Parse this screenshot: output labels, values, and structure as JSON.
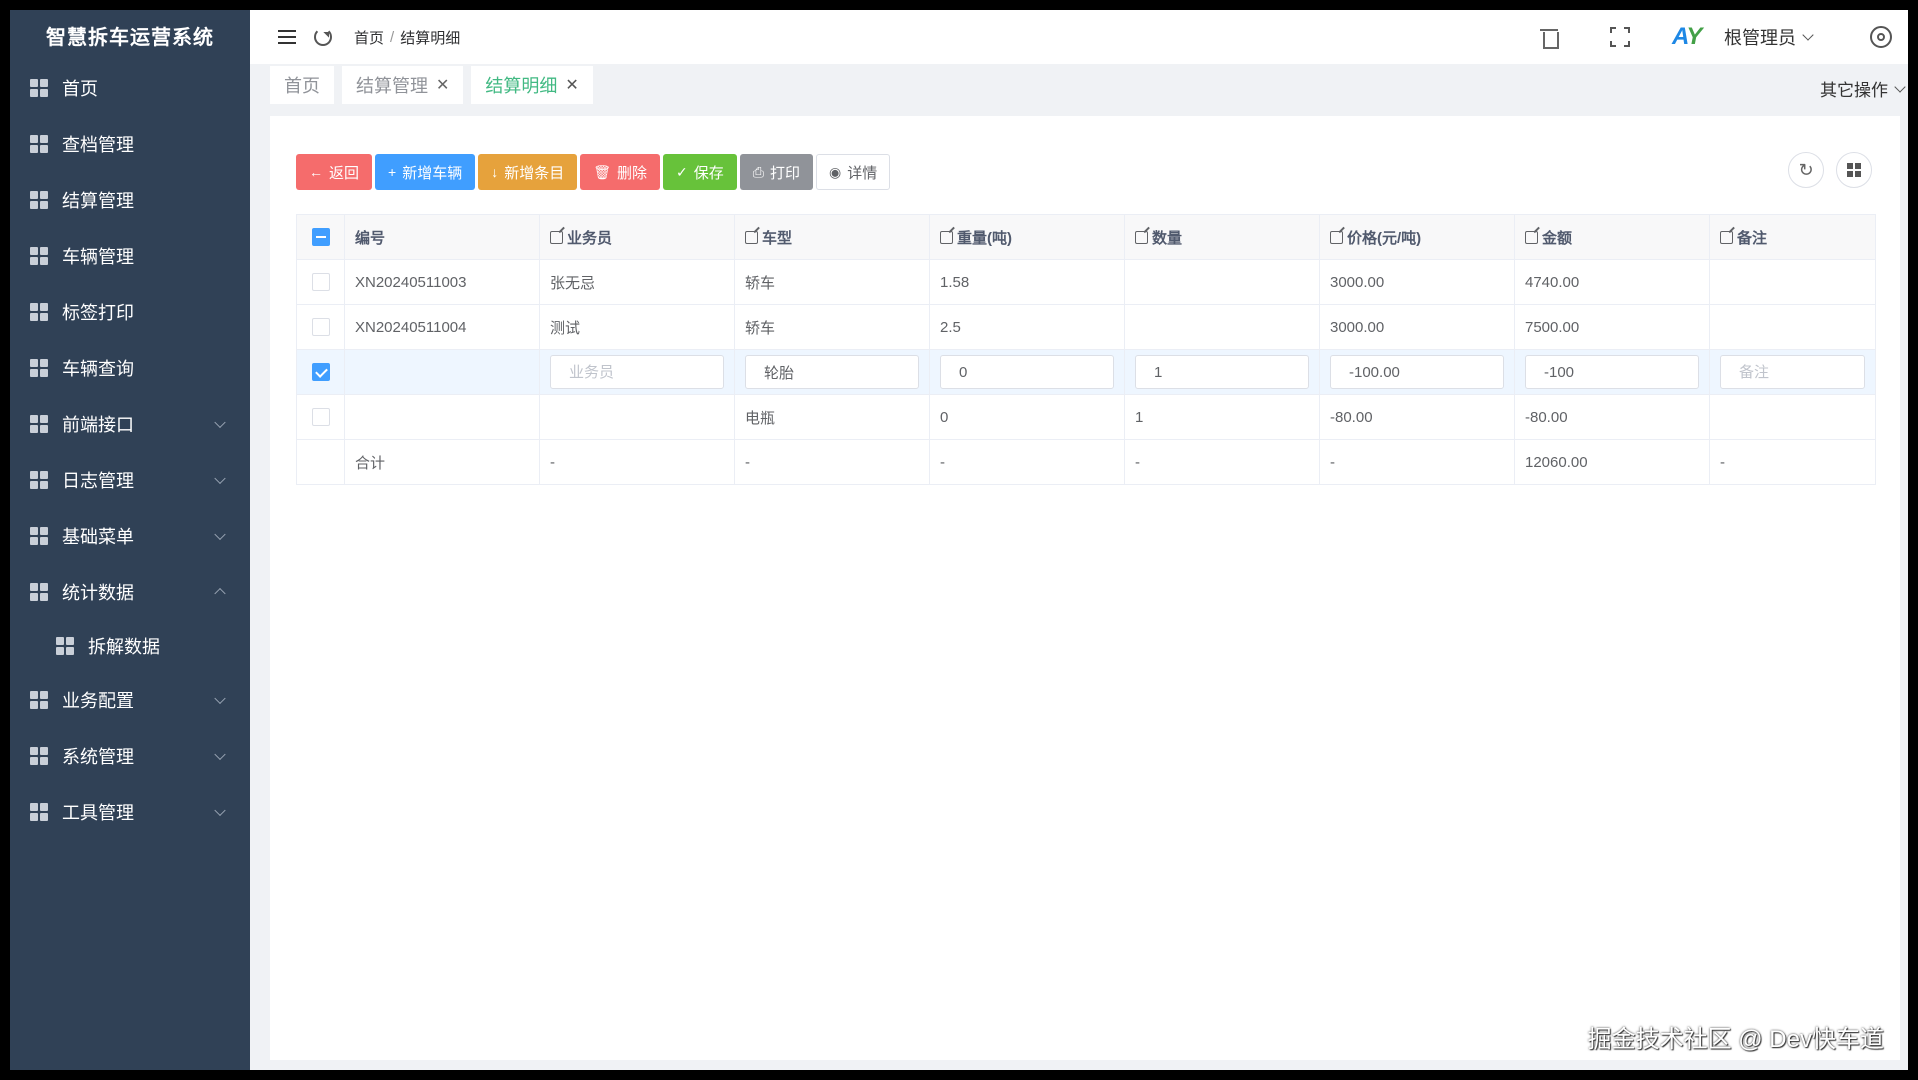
{
  "app_title": "智慧拆车运营系统",
  "sidebar": {
    "items": [
      {
        "label": "首页",
        "has_chevron": false
      },
      {
        "label": "查档管理",
        "has_chevron": false
      },
      {
        "label": "结算管理",
        "has_chevron": false
      },
      {
        "label": "车辆管理",
        "has_chevron": false
      },
      {
        "label": "标签打印",
        "has_chevron": false
      },
      {
        "label": "车辆查询",
        "has_chevron": false
      },
      {
        "label": "前端接口",
        "has_chevron": true
      },
      {
        "label": "日志管理",
        "has_chevron": true
      },
      {
        "label": "基础菜单",
        "has_chevron": true
      },
      {
        "label": "统计数据",
        "has_chevron": true,
        "expanded": true
      },
      {
        "label": "拆解数据",
        "sub": true
      },
      {
        "label": "业务配置",
        "has_chevron": true
      },
      {
        "label": "系统管理",
        "has_chevron": true
      },
      {
        "label": "工具管理",
        "has_chevron": true
      }
    ]
  },
  "header": {
    "breadcrumb": [
      "首页",
      "结算明细"
    ],
    "breadcrumb_sep": "/",
    "avatar_text": [
      "A",
      "Y"
    ],
    "user_name": "根管理员"
  },
  "tags": [
    {
      "label": "首页",
      "closable": false,
      "active": false
    },
    {
      "label": "结算管理",
      "closable": true,
      "active": false
    },
    {
      "label": "结算明细",
      "closable": true,
      "active": true
    }
  ],
  "tag_close": "✕",
  "other_ops": "其它操作",
  "toolbar": {
    "back": {
      "icon": "←",
      "label": "返回"
    },
    "add_vehicle": {
      "icon": "+",
      "label": "新增车辆"
    },
    "add_item": {
      "icon": "↓",
      "label": "新增条目"
    },
    "delete": {
      "icon": "🗑",
      "label": "删除"
    },
    "save": {
      "icon": "✓",
      "label": "保存"
    },
    "print": {
      "icon": "⎙",
      "label": "打印"
    },
    "detail": {
      "icon": "◉",
      "label": "详情"
    }
  },
  "right_tools": {
    "refresh": "↻"
  },
  "table": {
    "columns": [
      "编号",
      "业务员",
      "车型",
      "重量(吨)",
      "数量",
      "价格(元/吨)",
      "金额",
      "备注"
    ],
    "rows": [
      {
        "checked": false,
        "cells": [
          "XN20240511003",
          "张无忌",
          "轿车",
          "1.58",
          "",
          "3000.00",
          "4740.00",
          ""
        ]
      },
      {
        "checked": false,
        "cells": [
          "XN20240511004",
          "测试",
          "轿车",
          "2.5",
          "",
          "3000.00",
          "7500.00",
          ""
        ]
      },
      {
        "checked": true,
        "editing": true,
        "inputs": {
          "salesman": {
            "value": "",
            "placeholder": "业务员"
          },
          "model": {
            "value": "轮胎"
          },
          "weight": {
            "value": "0"
          },
          "qty": {
            "value": "1"
          },
          "price": {
            "value": "-100.00"
          },
          "amount": {
            "value": "-100"
          },
          "remark": {
            "value": "",
            "placeholder": "备注"
          }
        }
      },
      {
        "checked": false,
        "cells": [
          "",
          "",
          "电瓶",
          "0",
          "1",
          "-80.00",
          "-80.00",
          ""
        ]
      }
    ],
    "summary": [
      "合计",
      "-",
      "-",
      "-",
      "-",
      "-",
      "12060.00",
      "-"
    ]
  },
  "watermark": "掘金技术社区 @ Dev快车道",
  "colors": {
    "sidebar_bg": "#304156",
    "active_tag": "#42b983",
    "primary": "#409eff",
    "danger": "#f56c6c",
    "warning": "#e6a23c",
    "success": "#67c23a",
    "info": "#909399"
  }
}
